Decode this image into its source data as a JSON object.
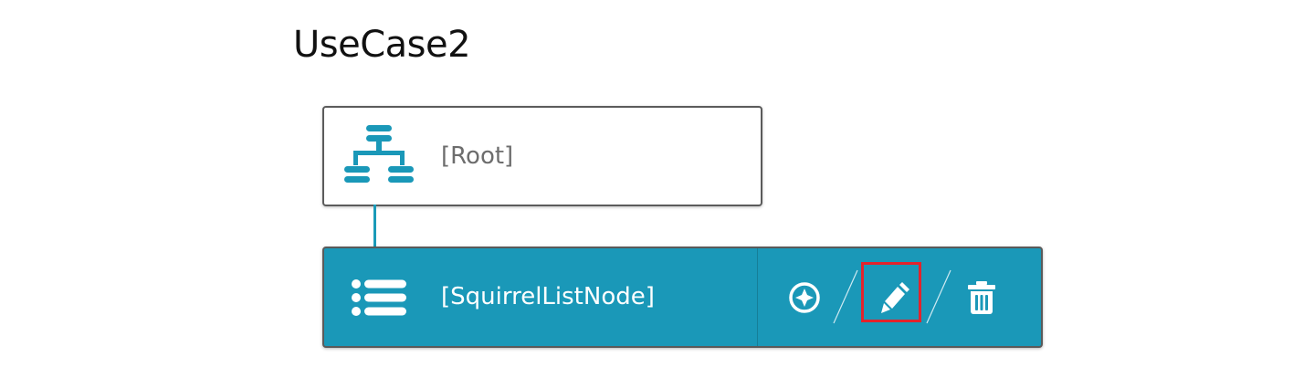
{
  "page": {
    "title": "UseCase2"
  },
  "tree": {
    "root_node": {
      "label": "[Root]",
      "icon": "sitemap-icon"
    },
    "child_node": {
      "label": "[SquirrelListNode]",
      "icon": "list-icon",
      "actions": [
        {
          "name": "move",
          "icon": "compass-icon"
        },
        {
          "name": "edit",
          "icon": "pencil-icon",
          "highlighted": true
        },
        {
          "name": "delete",
          "icon": "trash-icon"
        }
      ]
    }
  },
  "colors": {
    "accent": "#1a98b8",
    "highlight": "#e3232c",
    "border": "#5b5b5b"
  }
}
